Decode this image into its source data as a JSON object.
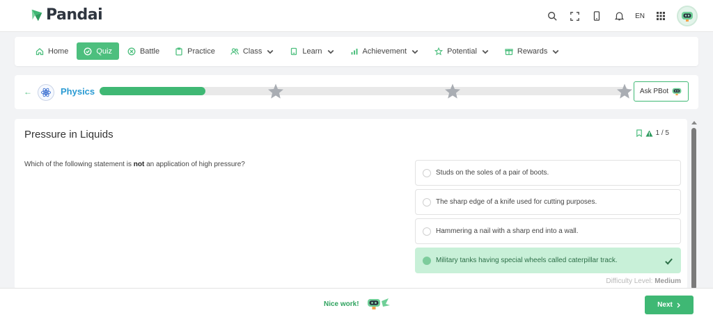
{
  "brand": {
    "name": "Pandai"
  },
  "header": {
    "language": "EN"
  },
  "nav": {
    "items": [
      {
        "label": "Home",
        "icon": "home-icon"
      },
      {
        "label": "Quiz",
        "icon": "check-circle-icon",
        "active": true
      },
      {
        "label": "Battle",
        "icon": "battle-icon"
      },
      {
        "label": "Practice",
        "icon": "clipboard-icon"
      },
      {
        "label": "Class",
        "icon": "users-icon",
        "dropdown": true
      },
      {
        "label": "Learn",
        "icon": "book-icon",
        "dropdown": true
      },
      {
        "label": "Achievement",
        "icon": "bar-chart-icon",
        "dropdown": true
      },
      {
        "label": "Potential",
        "icon": "star-outline-icon",
        "dropdown": true
      },
      {
        "label": "Rewards",
        "icon": "gift-icon",
        "dropdown": true
      }
    ]
  },
  "progress": {
    "subject": "Physics",
    "fraction": 0.2,
    "stars": 3,
    "ask_label": "Ask PBot"
  },
  "question": {
    "title": "Pressure in Liquids",
    "counter": "1 / 5",
    "text_before": "Which of the following statement is ",
    "text_bold": "not",
    "text_after": " an application of high pressure?",
    "options": [
      {
        "text": "Studs on the soles of a pair of boots.",
        "correct": false
      },
      {
        "text": "The sharp edge of a knife used for cutting purposes.",
        "correct": false
      },
      {
        "text": "Hammering a nail with a sharp end into a wall.",
        "correct": false
      },
      {
        "text": "Military tanks having special wheels called caterpillar track.",
        "correct": true
      }
    ],
    "difficulty_label": "Difficulty Level:",
    "difficulty_value": "Medium"
  },
  "footer": {
    "feedback": "Nice work!",
    "next_label": "Next"
  },
  "colors": {
    "accent": "#3fb874",
    "correct_bg": "#c8f0d8",
    "subject": "#2b9bd3"
  }
}
